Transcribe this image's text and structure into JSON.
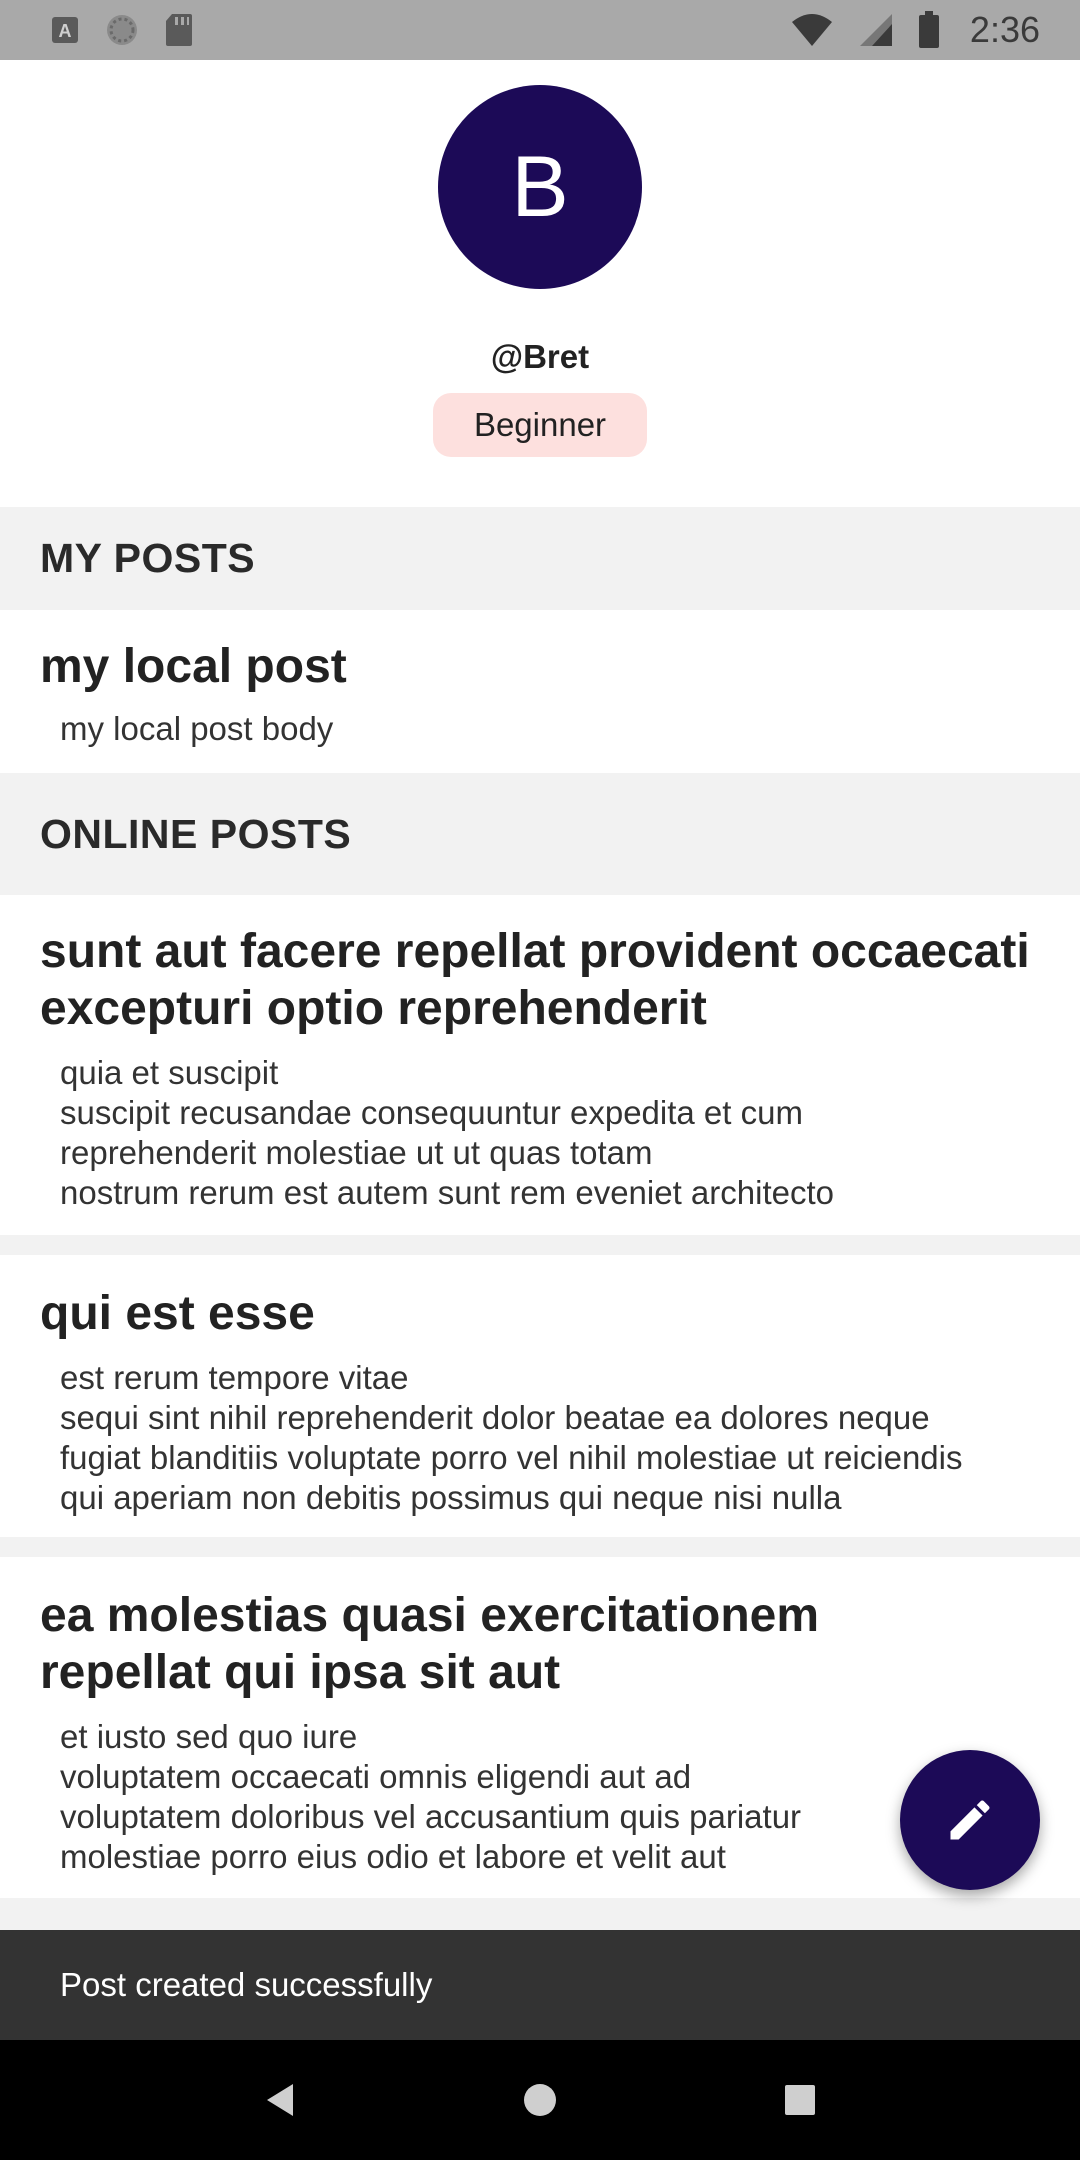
{
  "status_bar": {
    "time": "2:36",
    "left_icons": [
      "text-a-icon",
      "loading-circle-icon",
      "sd-card-icon"
    ],
    "right_icons": [
      "wifi-icon",
      "signal-icon",
      "battery-icon"
    ]
  },
  "profile": {
    "avatar_letter": "B",
    "username": "@Bret",
    "level": "Beginner",
    "avatar_color": "#1c0a57",
    "chip_color": "#fde0de"
  },
  "sections": {
    "my_posts": "MY POSTS",
    "online_posts": "ONLINE POSTS"
  },
  "my_posts": [
    {
      "title": "my local post",
      "body": "my local post body"
    }
  ],
  "online_posts": [
    {
      "title": "sunt aut facere repellat provident occaecati excepturi optio reprehenderit",
      "body": "quia et suscipit\nsuscipit recusandae consequuntur expedita et cum\nreprehenderit molestiae ut ut quas totam\nnostrum rerum est autem sunt rem eveniet architecto"
    },
    {
      "title": "qui est esse",
      "body": "est rerum tempore vitae\nsequi sint nihil reprehenderit dolor beatae ea dolores neque\nfugiat blanditiis voluptate porro vel nihil molestiae ut reiciendis\nqui aperiam non debitis possimus qui neque nisi nulla"
    },
    {
      "title": "ea molestias quasi exercitationem repellat qui ipsa sit aut",
      "body": "et iusto sed quo iure\nvoluptatem occaecati omnis eligendi aut ad\nvoluptatem doloribus vel accusantium quis pariatur\nmolestiae porro eius odio et labore et velit aut"
    }
  ],
  "fab": {
    "icon": "pencil-icon"
  },
  "snackbar": {
    "message": "Post created successfully"
  },
  "nav_bar": {
    "icons": [
      "back-icon",
      "home-icon",
      "recents-icon"
    ]
  }
}
